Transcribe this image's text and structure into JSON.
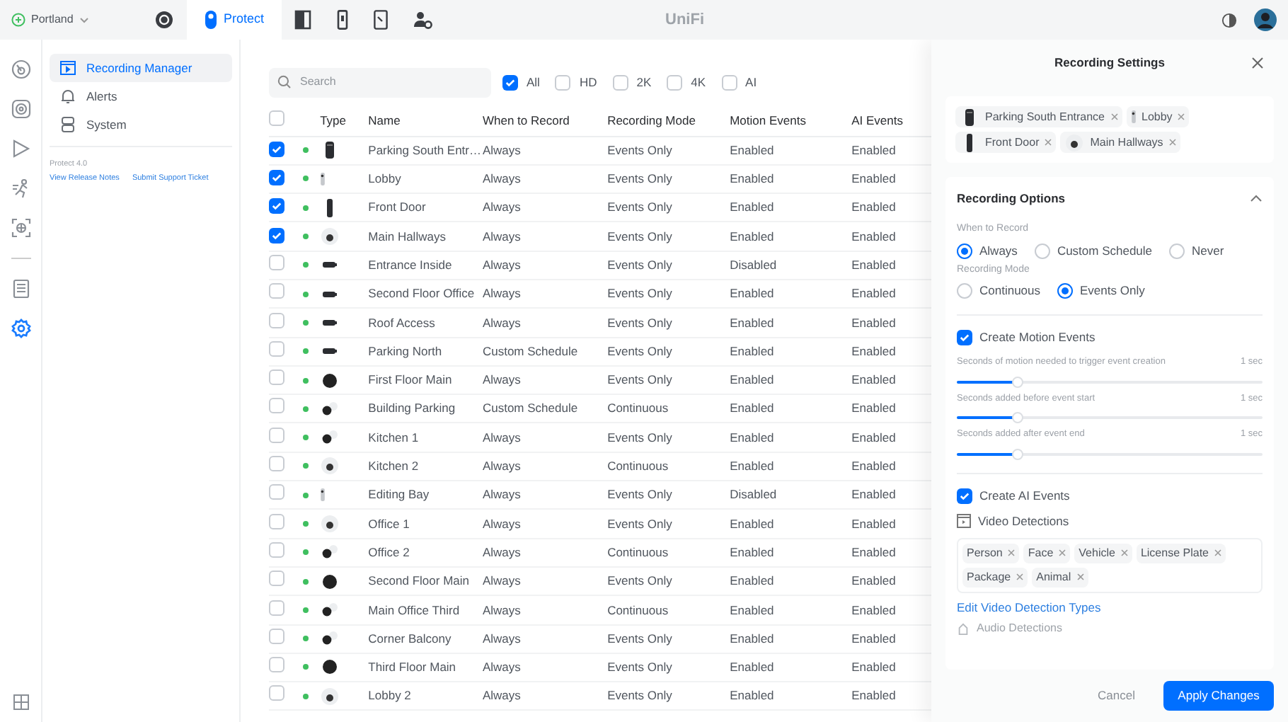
{
  "topbar": {
    "site": "Portland",
    "app_tabs": [
      {
        "kind": "console",
        "selected": false
      },
      {
        "kind": "protect",
        "selected": true,
        "label": "Protect"
      },
      {
        "kind": "access",
        "selected": false
      },
      {
        "kind": "talk",
        "selected": false
      },
      {
        "kind": "connect",
        "selected": false
      },
      {
        "kind": "users",
        "selected": false
      }
    ],
    "brand": "UniFi"
  },
  "rail": [
    {
      "kind": "dashboard",
      "selected": false
    },
    {
      "kind": "devices",
      "selected": false
    },
    {
      "kind": "playback",
      "selected": false
    },
    {
      "kind": "detections",
      "selected": false
    },
    {
      "kind": "scan",
      "selected": false
    },
    {
      "kind": "divider"
    },
    {
      "kind": "logs",
      "selected": false
    },
    {
      "kind": "settings",
      "selected": true
    }
  ],
  "sidebar": {
    "items": [
      {
        "kind": "recording",
        "label": "Recording Manager",
        "selected": true
      },
      {
        "kind": "alerts",
        "label": "Alerts",
        "selected": false
      },
      {
        "kind": "system",
        "label": "System",
        "selected": false
      }
    ],
    "version": "Protect 4.0",
    "links": [
      "View Release Notes",
      "Submit Support Ticket"
    ]
  },
  "filters": {
    "search": {
      "placeholder": "Search"
    },
    "options": [
      {
        "label": "All",
        "checked": true
      },
      {
        "label": "HD",
        "checked": false
      },
      {
        "label": "2K",
        "checked": false
      },
      {
        "label": "4K",
        "checked": false
      },
      {
        "label": "AI",
        "checked": false
      }
    ]
  },
  "table": {
    "select_all": false,
    "columns": [
      "Type",
      "Name",
      "When to Record",
      "Recording Mode",
      "Motion Events",
      "AI Events"
    ],
    "rows": [
      {
        "selected": true,
        "online": true,
        "kind": "bullet",
        "name": "Parking South Entr…",
        "when": "Always",
        "mode": "Events Only",
        "motion": "Enabled",
        "ai": "Enabled"
      },
      {
        "selected": true,
        "online": true,
        "kind": "mini",
        "name": "Lobby",
        "when": "Always",
        "mode": "Events Only",
        "motion": "Enabled",
        "ai": "Enabled"
      },
      {
        "selected": true,
        "online": true,
        "kind": "doorbell",
        "name": "Front Door",
        "when": "Always",
        "mode": "Events Only",
        "motion": "Enabled",
        "ai": "Enabled"
      },
      {
        "selected": true,
        "online": true,
        "kind": "dome",
        "name": "Main Hallways",
        "when": "Always",
        "mode": "Events Only",
        "motion": "Enabled",
        "ai": "Enabled"
      },
      {
        "selected": false,
        "online": true,
        "kind": "box",
        "name": "Entrance Inside",
        "when": "Always",
        "mode": "Events Only",
        "motion": "Disabled",
        "ai": "Enabled"
      },
      {
        "selected": false,
        "online": true,
        "kind": "box",
        "name": "Second Floor Office",
        "when": "Always",
        "mode": "Events Only",
        "motion": "Enabled",
        "ai": "Enabled"
      },
      {
        "selected": false,
        "online": true,
        "kind": "box",
        "name": "Roof Access",
        "when": "Always",
        "mode": "Events Only",
        "motion": "Enabled",
        "ai": "Enabled"
      },
      {
        "selected": false,
        "online": true,
        "kind": "box",
        "name": "Parking North",
        "when": "Custom Schedule",
        "mode": "Events Only",
        "motion": "Enabled",
        "ai": "Enabled"
      },
      {
        "selected": false,
        "online": true,
        "kind": "ball",
        "name": "First Floor Main",
        "when": "Always",
        "mode": "Events Only",
        "motion": "Enabled",
        "ai": "Enabled"
      },
      {
        "selected": false,
        "online": true,
        "kind": "turret",
        "name": "Building Parking",
        "when": "Custom Schedule",
        "mode": "Continuous",
        "motion": "Enabled",
        "ai": "Enabled"
      },
      {
        "selected": false,
        "online": true,
        "kind": "turret",
        "name": "Kitchen 1",
        "when": "Always",
        "mode": "Events Only",
        "motion": "Enabled",
        "ai": "Enabled"
      },
      {
        "selected": false,
        "online": true,
        "kind": "dome",
        "name": "Kitchen 2",
        "when": "Always",
        "mode": "Continuous",
        "motion": "Enabled",
        "ai": "Enabled"
      },
      {
        "selected": false,
        "online": true,
        "kind": "mini",
        "name": "Editing Bay",
        "when": "Always",
        "mode": "Events Only",
        "motion": "Disabled",
        "ai": "Enabled"
      },
      {
        "selected": false,
        "online": true,
        "kind": "dome",
        "name": "Office 1",
        "when": "Always",
        "mode": "Events Only",
        "motion": "Enabled",
        "ai": "Enabled"
      },
      {
        "selected": false,
        "online": true,
        "kind": "turret",
        "name": "Office 2",
        "when": "Always",
        "mode": "Continuous",
        "motion": "Enabled",
        "ai": "Enabled"
      },
      {
        "selected": false,
        "online": true,
        "kind": "ball",
        "name": "Second Floor Main",
        "when": "Always",
        "mode": "Events Only",
        "motion": "Enabled",
        "ai": "Enabled"
      },
      {
        "selected": false,
        "online": true,
        "kind": "turret",
        "name": "Main Office Third",
        "when": "Always",
        "mode": "Continuous",
        "motion": "Enabled",
        "ai": "Enabled"
      },
      {
        "selected": false,
        "online": true,
        "kind": "turret",
        "name": "Corner Balcony",
        "when": "Always",
        "mode": "Events Only",
        "motion": "Enabled",
        "ai": "Enabled"
      },
      {
        "selected": false,
        "online": true,
        "kind": "ball",
        "name": "Third Floor Main",
        "when": "Always",
        "mode": "Events Only",
        "motion": "Enabled",
        "ai": "Enabled"
      },
      {
        "selected": false,
        "online": true,
        "kind": "dome",
        "name": "Lobby 2",
        "when": "Always",
        "mode": "Events Only",
        "motion": "Enabled",
        "ai": "Enabled"
      }
    ]
  },
  "panel": {
    "title": "Recording Settings",
    "cameras": [
      {
        "kind": "bullet",
        "name": "Parking South Entrance"
      },
      {
        "kind": "mini",
        "name": "Lobby"
      },
      {
        "kind": "doorbell",
        "name": "Front Door"
      },
      {
        "kind": "dome",
        "name": "Main Hallways"
      }
    ],
    "section": {
      "title": "Recording Options",
      "expanded": true
    },
    "when_to_record": {
      "label": "When to Record",
      "options": [
        {
          "label": "Always",
          "selected": true
        },
        {
          "label": "Custom Schedule",
          "selected": false
        },
        {
          "label": "Never",
          "selected": false
        }
      ]
    },
    "recording_mode": {
      "label": "Recording Mode",
      "options": [
        {
          "label": "Continuous",
          "selected": false
        },
        {
          "label": "Events Only",
          "selected": true
        }
      ]
    },
    "motion": {
      "label": "Create Motion Events",
      "checked": true,
      "sliders": [
        {
          "label": "Seconds of motion needed to trigger event creation",
          "reading": "1 sec",
          "level": 0.2
        },
        {
          "label": "Seconds added before event start",
          "reading": "1 sec",
          "level": 0.2
        },
        {
          "label": "Seconds added after event end",
          "reading": "1 sec",
          "level": 0.2
        }
      ]
    },
    "ai": {
      "label": "Create AI Events",
      "checked": true,
      "video_label": "Video Detections",
      "tags": [
        "Person",
        "Face",
        "Vehicle",
        "License Plate",
        "Package",
        "Animal"
      ],
      "edit_link": "Edit Video Detection Types",
      "audio_label": "Audio Detections"
    },
    "buttons": {
      "cancel": "Cancel",
      "apply": "Apply Changes"
    }
  }
}
